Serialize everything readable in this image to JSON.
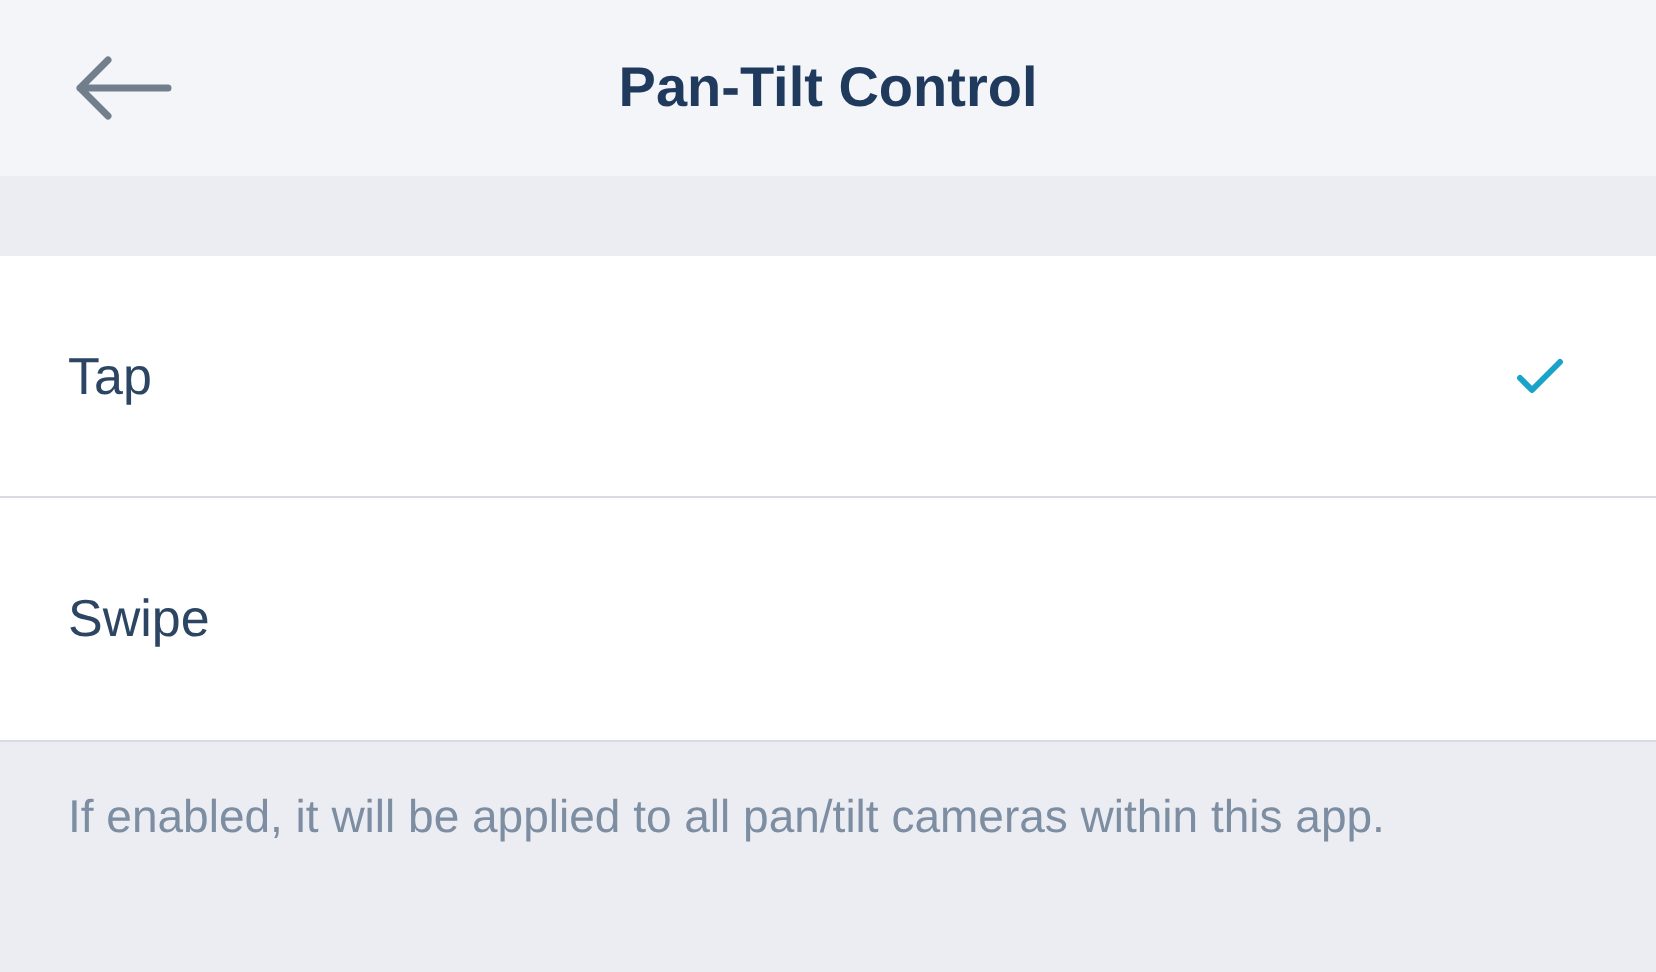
{
  "header": {
    "title": "Pan-Tilt Control"
  },
  "options": [
    {
      "label": "Tap",
      "selected": true
    },
    {
      "label": "Swipe",
      "selected": false
    }
  ],
  "footer_note": "If enabled, it will be applied to all pan/tilt cameras within this app."
}
